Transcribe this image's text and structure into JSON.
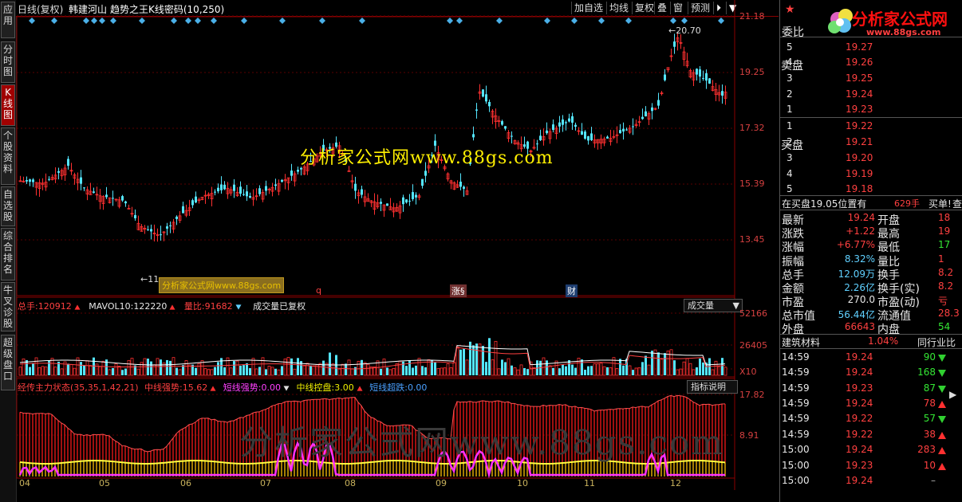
{
  "left_tabs": [
    "应用",
    "分时图",
    "K线图",
    "个股资料",
    "自选股",
    "综合排名",
    "牛叉诊股",
    "超级盘口"
  ],
  "header": {
    "period": "日线(复权)",
    "stock_name": "韩建河山",
    "indicator_title": "趋势之王K线密码(10,250)",
    "buttons": [
      "加自选",
      "均线",
      "复权",
      "叠",
      "窗",
      "预测"
    ],
    "arrow_icon": "⏵"
  },
  "price_axis": [
    "21.18",
    "19.25",
    "17.32",
    "15.39",
    "13.45"
  ],
  "price_markers": {
    "high": "20.70",
    "low": "11"
  },
  "watermark_main": "分析家公式网www.88gs.com",
  "watermark_inline": "分析家公式网www.88gs.com",
  "watermark_lower": "分析家公式网www.88gs.com",
  "event_tags": [
    "q",
    "涨§",
    "财"
  ],
  "volume_header": {
    "total_label": "总手:",
    "total": "120912",
    "mavol_label": "MAVOL10:",
    "mavol": "122220",
    "ratio_label": "量比:",
    "ratio": "91682",
    "note": "成交量已复权",
    "dropdown": "成交量"
  },
  "volume_axis": [
    "52166",
    "26405",
    "X10"
  ],
  "indicator_header": {
    "name": "经传主力状态(35,35,1,42,21)",
    "strong_label": "中线强势:",
    "strong": "15.62",
    "short_label": "短线强势:",
    "short": "0.00",
    "ctrl_label": "中线控盘:",
    "ctrl": "3.00",
    "over_label": "短线超跌:",
    "over": "0.00",
    "button": "指标说明"
  },
  "indicator_axis": [
    "17.82",
    "8.91"
  ],
  "months": [
    "04",
    "05",
    "06",
    "07",
    "08",
    "09",
    "10",
    "11",
    "12"
  ],
  "logo": {
    "text": "分析家公式网",
    "url": "www.88gs.com"
  },
  "right": {
    "commission_label": "委比",
    "sell_label": "卖盘",
    "buy_label": "买盘",
    "sell": [
      [
        "5",
        "19.27"
      ],
      [
        "4",
        "19.26"
      ],
      [
        "3",
        "19.25"
      ],
      [
        "2",
        "19.24"
      ],
      [
        "1",
        "19.23"
      ]
    ],
    "buy": [
      [
        "1",
        "19.22"
      ],
      [
        "2",
        "19.21"
      ],
      [
        "3",
        "19.20"
      ],
      [
        "4",
        "19.19"
      ],
      [
        "5",
        "19.18"
      ]
    ],
    "pos_text": "在买盘19.05位置有",
    "pos_qty": "629手",
    "pos_buy": "买单!",
    "pos_link": "查看详",
    "stats": [
      [
        "最新",
        "19.24",
        "开盘",
        "18"
      ],
      [
        "涨跌",
        "+1.22",
        "最高",
        "19"
      ],
      [
        "涨幅",
        "+6.77%",
        "最低",
        "17"
      ],
      [
        "振幅",
        "8.32%",
        "量比",
        "1"
      ],
      [
        "总手",
        "12.09万",
        "换手",
        "8.2"
      ],
      [
        "金额",
        "2.26亿",
        "换手(实)",
        "8.2"
      ],
      [
        "市盈",
        "270.0",
        "市盈(动)",
        "亏"
      ],
      [
        "总市值",
        "56.44亿",
        "流通值",
        "28.3"
      ],
      [
        "外盘",
        "66643",
        "内盘",
        "54"
      ]
    ],
    "sector": "建筑材料",
    "sector_pct": "1.04%",
    "sector_btn": "同行业比",
    "ticks": [
      [
        "14:59",
        "19.24",
        "90",
        "dn"
      ],
      [
        "14:59",
        "19.24",
        "168",
        "dn"
      ],
      [
        "14:59",
        "19.23",
        "87",
        "dn"
      ],
      [
        "14:59",
        "19.24",
        "78",
        "up"
      ],
      [
        "14:59",
        "19.22",
        "57",
        "dn"
      ],
      [
        "14:59",
        "19.22",
        "38",
        "up"
      ],
      [
        "15:00",
        "19.24",
        "283",
        "up"
      ],
      [
        "15:00",
        "19.23",
        "10",
        "up"
      ],
      [
        "15:00",
        "19.24",
        "–",
        ""
      ]
    ]
  },
  "chart_data": {
    "type": "candlestick",
    "price_range": [
      11.0,
      21.5
    ],
    "close_high": "20.70",
    "volume_max": 52166
  }
}
